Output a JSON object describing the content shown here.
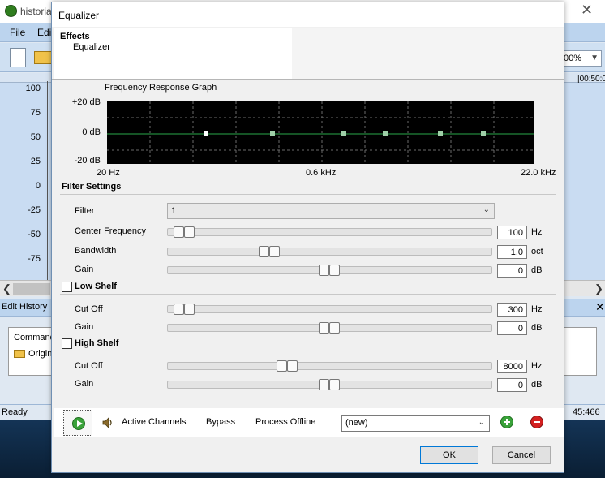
{
  "background_app": {
    "title": "historia",
    "close_glyph": "✕",
    "menu": [
      "File",
      "Edi"
    ],
    "zoom": "00%",
    "time_ruler": "|00:50:0",
    "amplitude_axis": [
      "100",
      "75",
      "50",
      "25",
      "0",
      "-25",
      "-50",
      "-75"
    ],
    "edit_history": {
      "title": "Edit History",
      "close_glyph": "✕",
      "column": "Command",
      "item": "Origina"
    },
    "status": {
      "text": "Ready",
      "time": "45:466"
    }
  },
  "dialog": {
    "title": "Equalizer",
    "effects": {
      "label": "Effects",
      "selected": "Equalizer"
    },
    "graph": {
      "title": "Frequency Response Graph",
      "y_labels": [
        "+20 dB",
        "0 dB",
        "-20 dB"
      ],
      "x_labels": [
        "20 Hz",
        "0.6 kHz",
        "22.0 kHz"
      ],
      "line_color": "#2aa84a",
      "marker_color": "#9fd0a8",
      "active_marker_color": "#ffffff"
    },
    "filter_settings": {
      "title": "Filter Settings",
      "filter_label": "Filter",
      "filter_value": "1",
      "center_frequency": {
        "label": "Center Frequency",
        "value": "100",
        "unit": "Hz",
        "position": 0.02
      },
      "bandwidth": {
        "label": "Bandwidth",
        "value": "1.0",
        "unit": "oct",
        "position": 0.3
      },
      "gain": {
        "label": "Gain",
        "value": "0",
        "unit": "dB",
        "position": 0.5
      }
    },
    "low_shelf": {
      "title": "Low Shelf",
      "checked": false,
      "cut_off": {
        "label": "Cut Off",
        "value": "300",
        "unit": "Hz",
        "position": 0.02
      },
      "gain": {
        "label": "Gain",
        "value": "0",
        "unit": "dB",
        "position": 0.5
      }
    },
    "high_shelf": {
      "title": "High Shelf",
      "checked": false,
      "cut_off": {
        "label": "Cut Off",
        "value": "8000",
        "unit": "Hz",
        "position": 0.36
      },
      "gain": {
        "label": "Gain",
        "value": "0",
        "unit": "dB",
        "position": 0.5
      }
    },
    "bottom": {
      "active_channels": "Active Channels",
      "bypass": "Bypass",
      "process_offline": "Process Offline",
      "preset": "(new)"
    },
    "buttons": {
      "ok": "OK",
      "cancel": "Cancel"
    }
  }
}
